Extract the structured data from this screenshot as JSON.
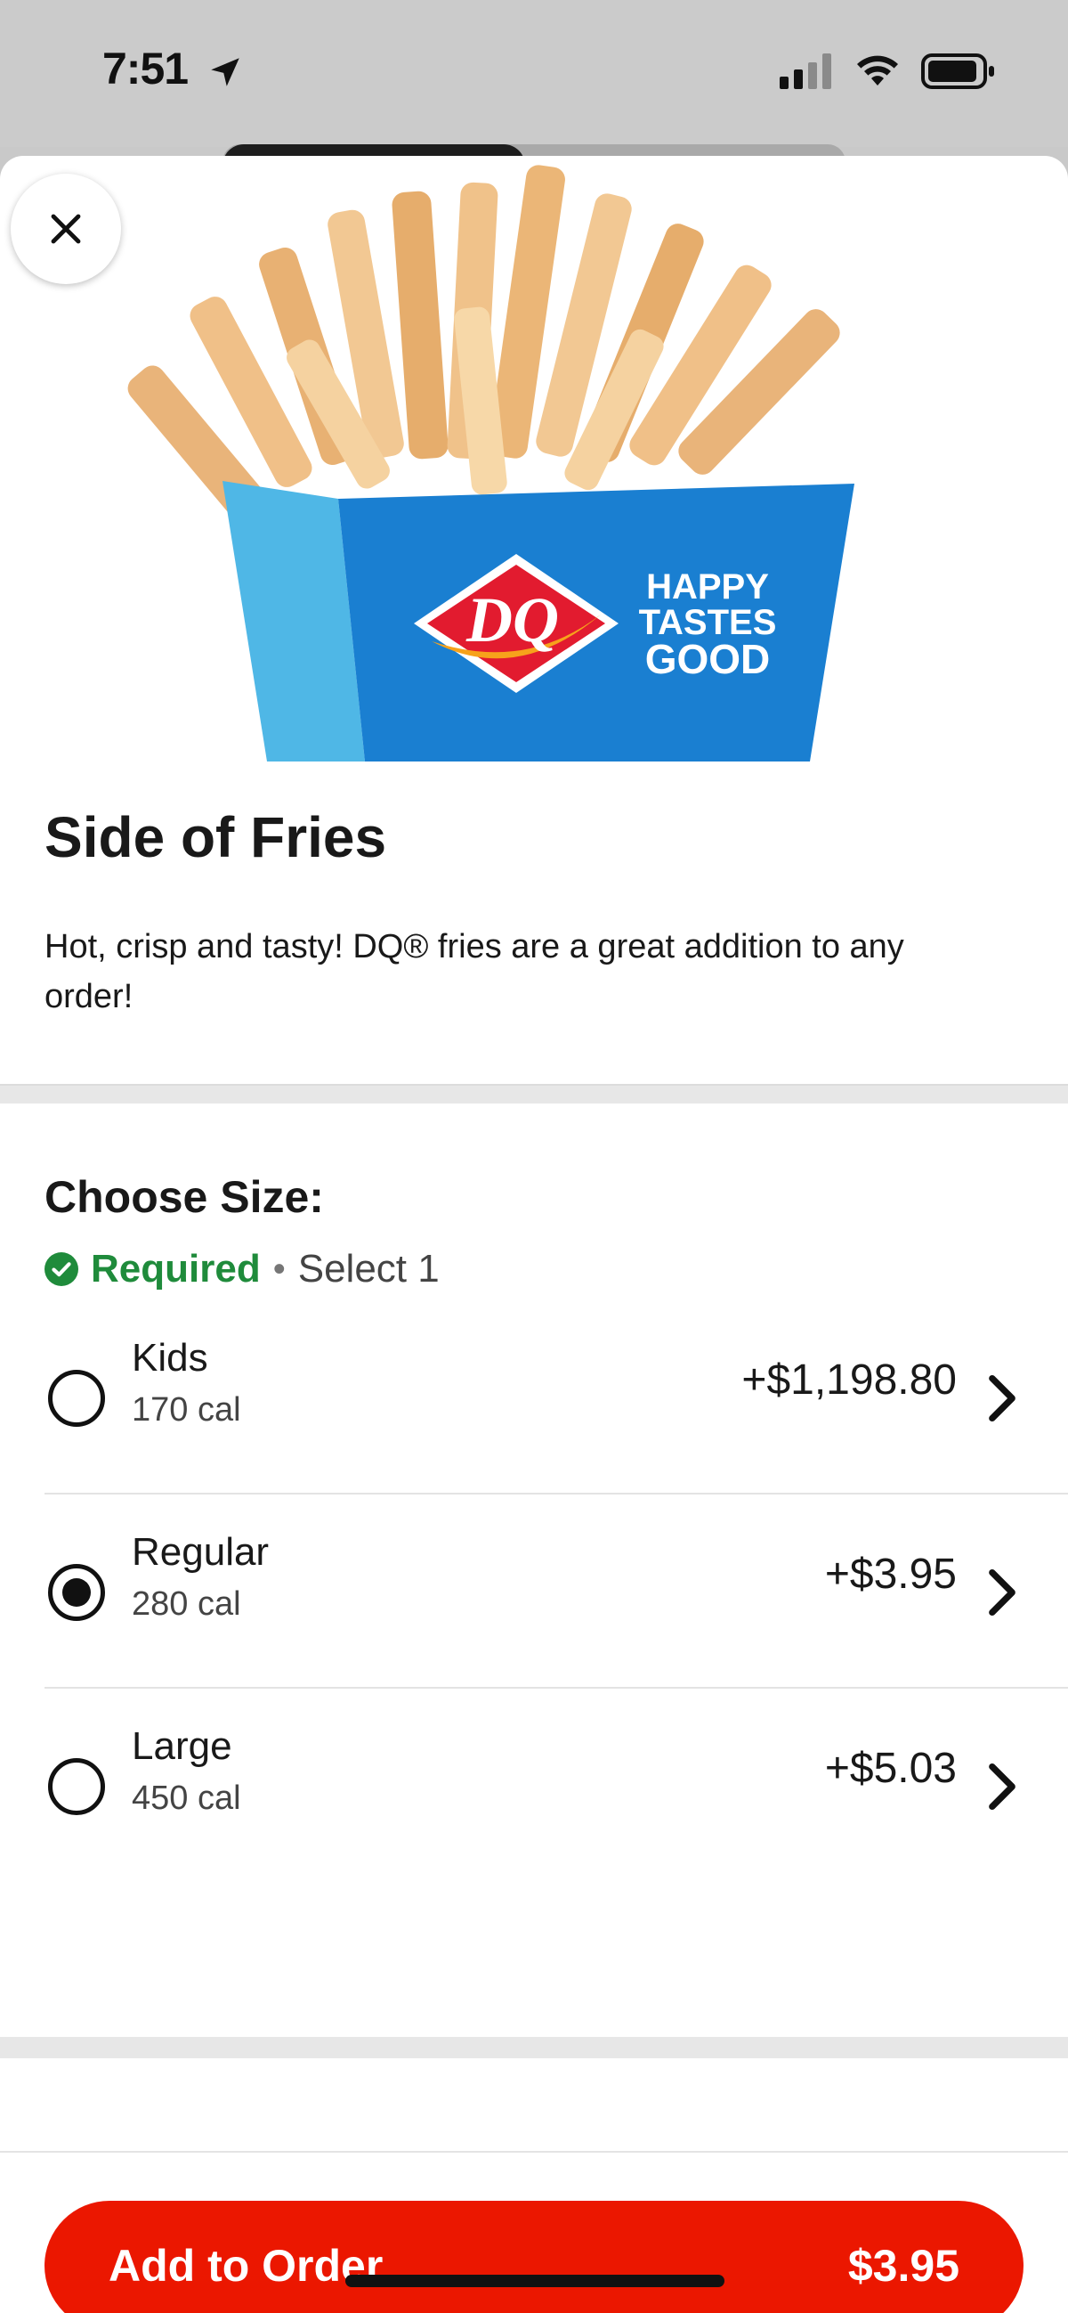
{
  "status_bar": {
    "time": "7:51",
    "icons": [
      "location-arrow-icon",
      "cellular-signal-icon",
      "wifi-icon",
      "battery-icon"
    ]
  },
  "item": {
    "title": "Side of Fries",
    "description": "Hot, crisp and tasty! DQ® fries are a great addition to any order!",
    "image_alt": "DQ fries in a blue Happy Tastes Good carton",
    "image_text": {
      "logo": "DQ",
      "slogan_lines": [
        "HAPPY",
        "TASTES",
        "GOOD"
      ]
    }
  },
  "size_section": {
    "title": "Choose Size:",
    "required_label": "Required",
    "separator": "•",
    "select_hint": "Select 1",
    "options": [
      {
        "name": "Kids",
        "calories": "170 cal",
        "price": "+$1,198.80",
        "selected": false
      },
      {
        "name": "Regular",
        "calories": "280 cal",
        "price": "+$3.95",
        "selected": true
      },
      {
        "name": "Large",
        "calories": "450 cal",
        "price": "+$5.03",
        "selected": false
      }
    ]
  },
  "footer": {
    "add_label": "Add to Order",
    "total": "$3.95"
  },
  "colors": {
    "accent": "#eb1700",
    "required_green": "#1f8b3b",
    "dq_red": "#e21b2f",
    "carton_blue": "#1a7fd1"
  }
}
